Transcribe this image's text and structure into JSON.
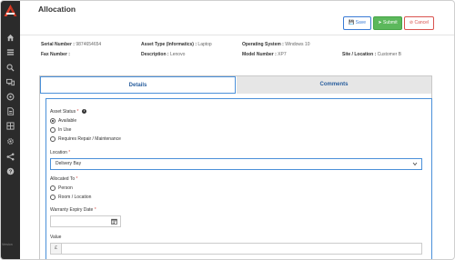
{
  "page": {
    "title": "Allocation"
  },
  "toolbar": {
    "save_label": "Save",
    "submit_label": "Submit",
    "cancel_label": "Cancel"
  },
  "asset_info": {
    "serial_number_label": "Serial Number :",
    "serial_number_value": "9874654654",
    "asset_type_label": "Asset Type (Informatics) :",
    "asset_type_value": "Laptop",
    "operating_system_label": "Operating System :",
    "operating_system_value": "Windows 10",
    "fax_number_label": "Fax Number :",
    "fax_number_value": "",
    "description_label": "Description :",
    "description_value": "Lenovo",
    "model_number_label": "Model Number :",
    "model_number_value": "XP7",
    "site_location_label": "Site / Location :",
    "site_location_value": "Customer B"
  },
  "tabs": [
    {
      "label": "Details",
      "active": true
    },
    {
      "label": "Comments",
      "active": false
    }
  ],
  "form": {
    "asset_status": {
      "label": "Asset Status",
      "required_mark": "*",
      "options": [
        "Available",
        "In Use",
        "Requires Repair / Maintenance"
      ],
      "selected": "Available"
    },
    "location": {
      "label": "Location",
      "required_mark": "*",
      "value": "Delivery Bay"
    },
    "allocated_to": {
      "label": "Allocated To",
      "required_mark": "*",
      "options": [
        "Person",
        "Room / Location"
      ]
    },
    "warranty_expiry_date": {
      "label": "Warranty Expiry Date",
      "required_mark": "*",
      "value": ""
    },
    "value": {
      "label": "Value",
      "currency_symbol": "£",
      "amount": ""
    }
  },
  "sidebar": {
    "icons": [
      "home-icon",
      "list-icon",
      "search-icon",
      "devices-icon",
      "settings-circle-icon",
      "document-icon",
      "grid-icon",
      "gear-icon",
      "share-icon",
      "help-icon"
    ],
    "version_text": "Version"
  },
  "colors": {
    "sidebar_bg": "#2b2b2b",
    "accent_blue": "#4a90d9",
    "submit_green": "#5cb85c",
    "cancel_red": "#d9534f",
    "tab_inactive_bg": "#e6e6e6"
  }
}
